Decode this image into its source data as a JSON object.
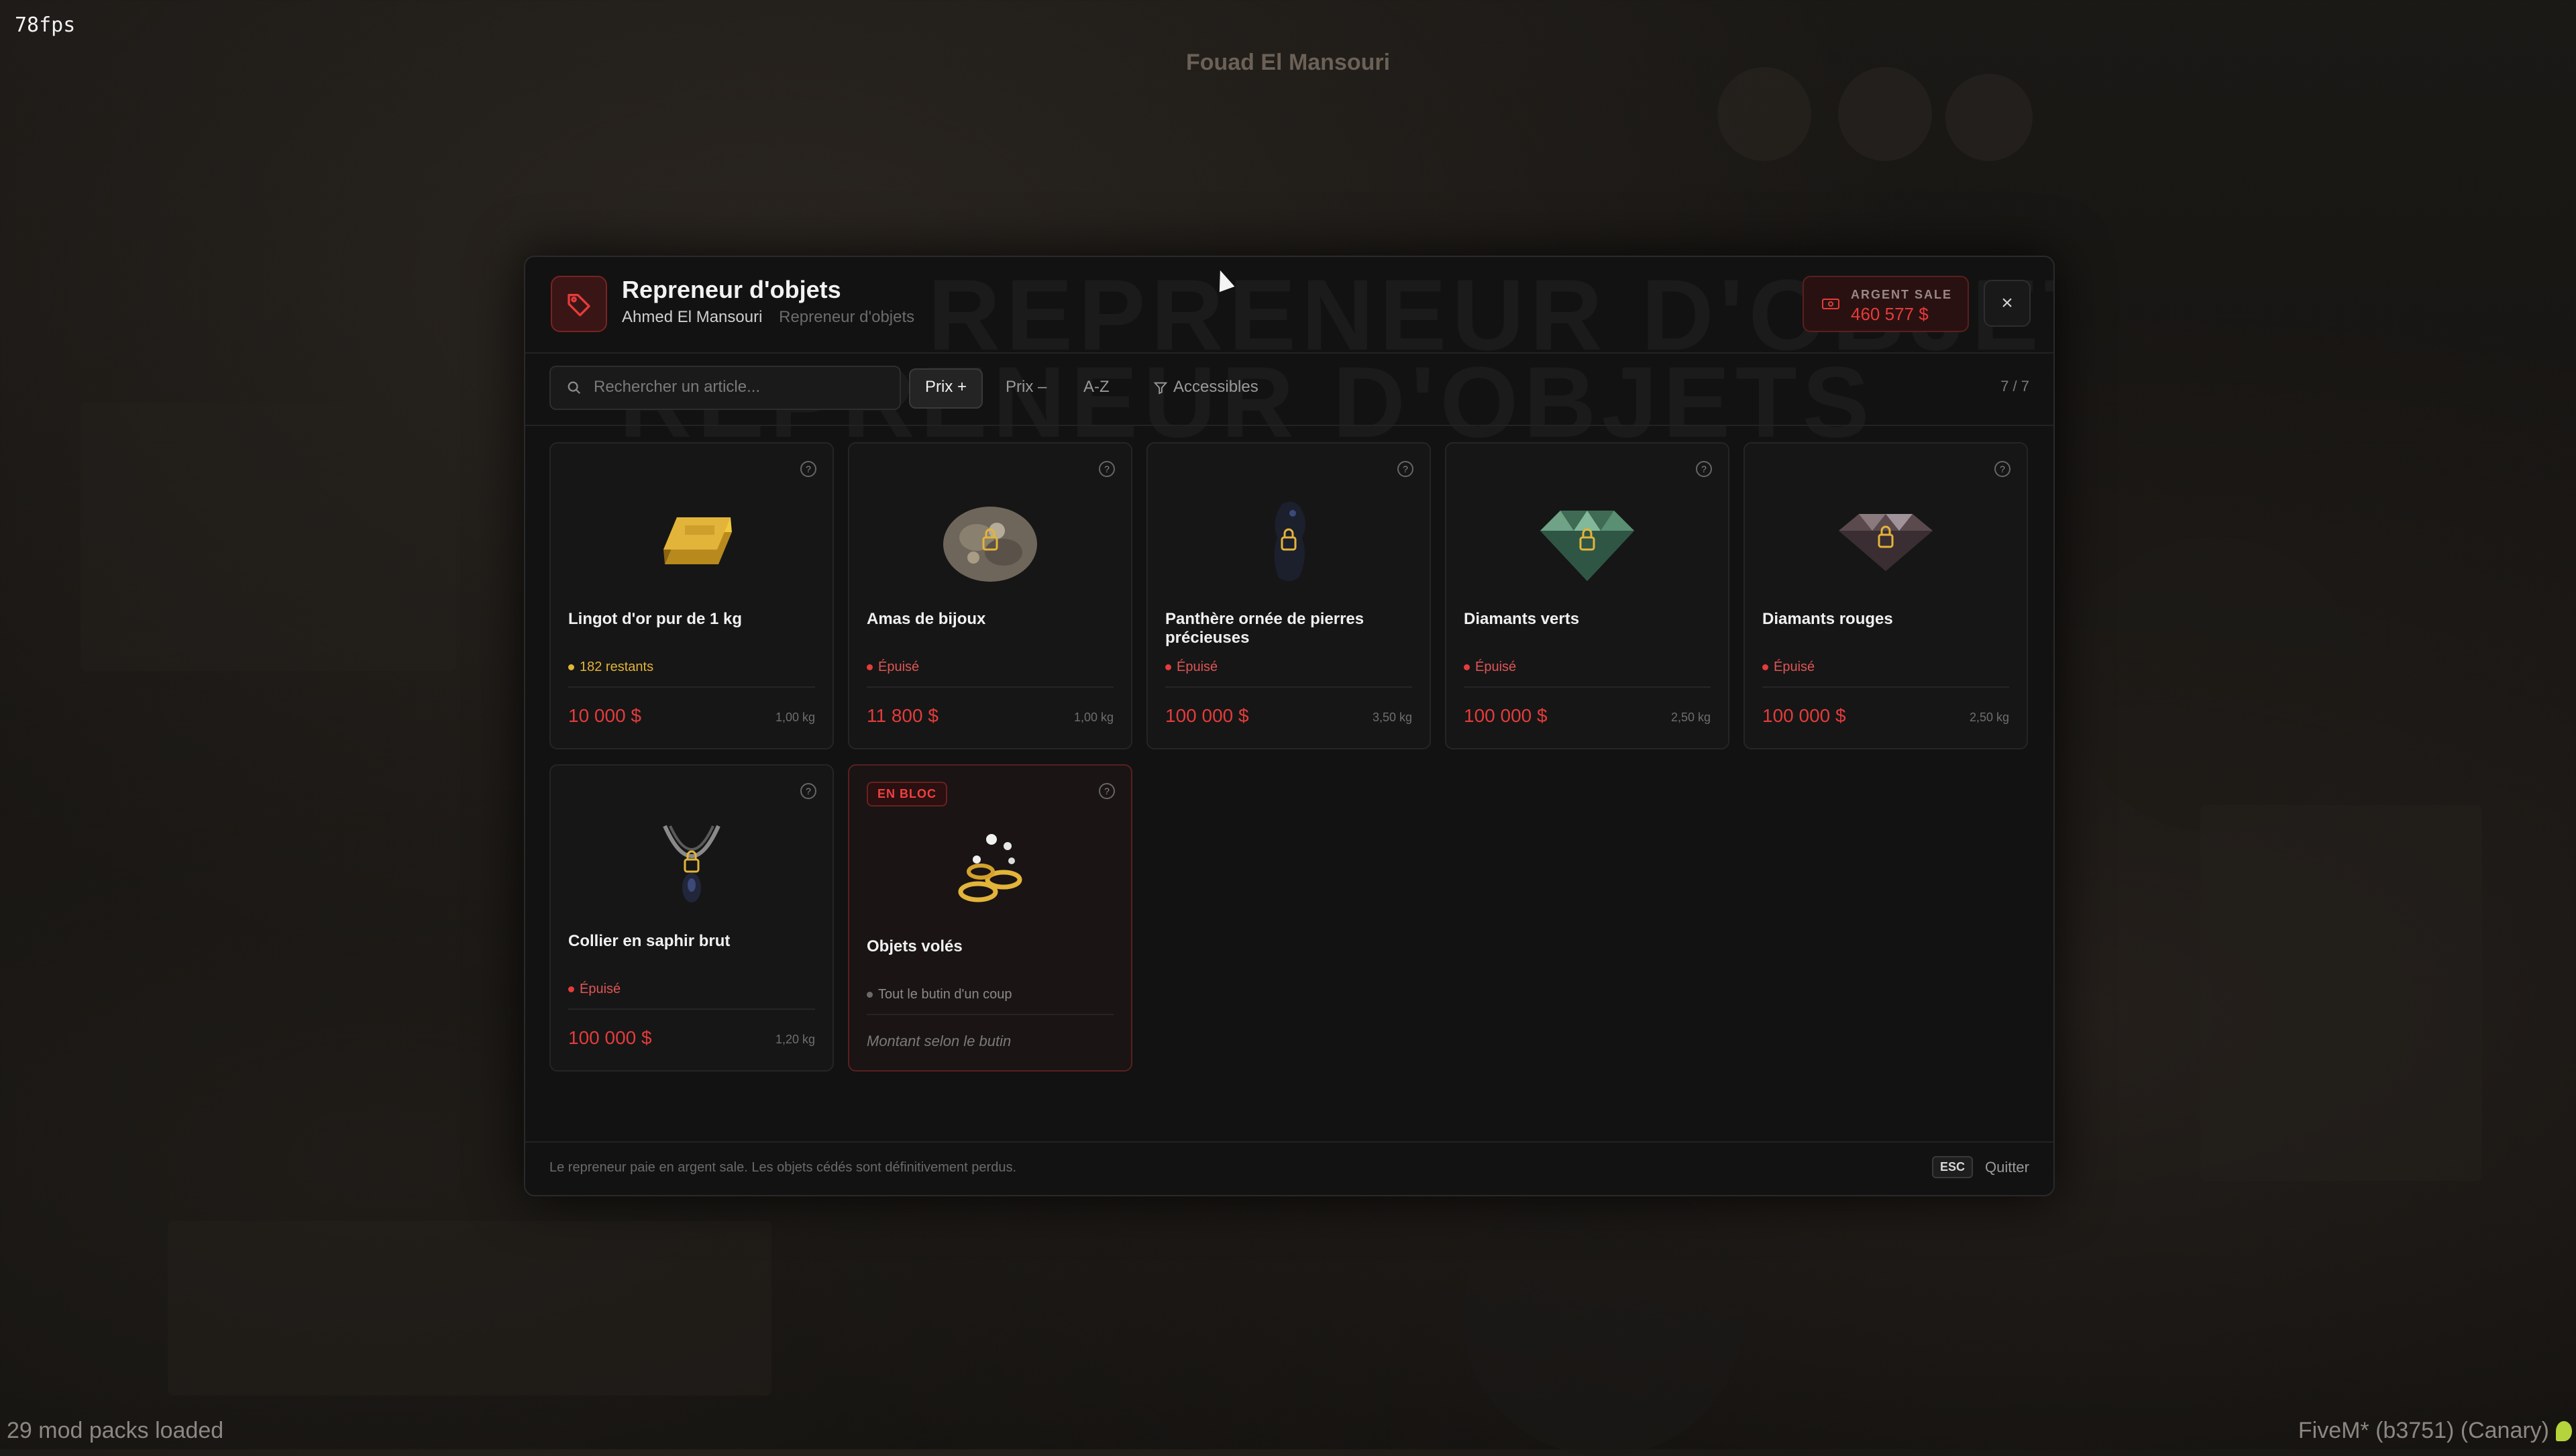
{
  "hud": {
    "fps": "78fps",
    "player_name": "Fouad El Mansouri",
    "mods_loaded": "29 mod packs loaded",
    "build": "FiveM* (b3751) (Canary)"
  },
  "colors": {
    "accent": "#e53b3b",
    "gold": "#e3b43a",
    "muted": "#7a7a7a"
  },
  "modal": {
    "watermark": "REPRENEUR D'OBJETS",
    "title": "Repreneur d'objets",
    "npc_name": "Ahmed El Mansouri",
    "npc_role": "Repreneur d'objets",
    "logo_icon": "tag-icon",
    "money_label": "ARGENT SALE",
    "money_value": "460 577 $",
    "close_label": "×"
  },
  "toolbar": {
    "search_placeholder": "Rechercher un article...",
    "sort_price_asc": "Prix +",
    "sort_price_desc": "Prix –",
    "sort_az": "A-Z",
    "filter_accessible": "Accessibles",
    "count": "7 / 7"
  },
  "items": [
    {
      "name": "Lingot d'or pur de 1 kg",
      "status": "182 restants",
      "status_type": "available",
      "price": "10 000 $",
      "weight": "1,00 kg",
      "icon": "gold-bar-icon",
      "locked": false
    },
    {
      "name": "Amas de bijoux",
      "status": "Épuisé",
      "status_type": "depleted",
      "price": "11 800 $",
      "weight": "1,00 kg",
      "icon": "jewels-icon",
      "locked": true
    },
    {
      "name": "Panthère ornée de pierres précieuses",
      "status": "Épuisé",
      "status_type": "depleted",
      "price": "100 000 $",
      "weight": "3,50 kg",
      "icon": "panther-statue-icon",
      "locked": true
    },
    {
      "name": "Diamants verts",
      "status": "Épuisé",
      "status_type": "depleted",
      "price": "100 000 $",
      "weight": "2,50 kg",
      "icon": "green-diamond-icon",
      "locked": true
    },
    {
      "name": "Diamants rouges",
      "status": "Épuisé",
      "status_type": "depleted",
      "price": "100 000 $",
      "weight": "2,50 kg",
      "icon": "red-diamond-icon",
      "locked": true
    },
    {
      "name": "Collier en saphir brut",
      "status": "Épuisé",
      "status_type": "depleted",
      "price": "100 000 $",
      "weight": "1,20 kg",
      "icon": "necklace-icon",
      "locked": true
    }
  ],
  "bulk_item": {
    "badge": "EN BLOC",
    "name": "Objets volés",
    "status": "Tout le butin d'un coup",
    "note": "Montant selon le butin",
    "icon": "rings-icon"
  },
  "footer": {
    "note": "Le repreneur paie en argent sale. Les objets cédés sont définitivement perdus.",
    "esc_key": "ESC",
    "quit_label": "Quitter"
  }
}
